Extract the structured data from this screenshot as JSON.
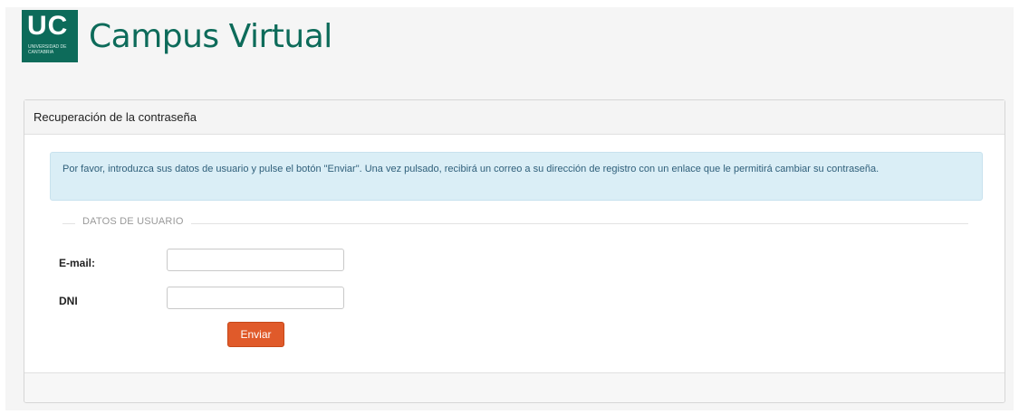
{
  "header": {
    "logo_text": "UC",
    "logo_subtext": "UNIVERSIDAD DE CANTABRIA",
    "brand_title": "Campus Virtual"
  },
  "panel": {
    "title": "Recuperación de la contraseña",
    "info_message": "Por favor, introduzca sus datos de usuario y pulse el botón \"Enviar\". Una vez pulsado, recibirá un correo a su dirección de registro con un enlace que le permitirá cambiar su contraseña.",
    "fieldset_legend": "DATOS DE USUARIO",
    "fields": {
      "email_label": "E-mail:",
      "email_value": "",
      "dni_label": "DNI",
      "dni_value": ""
    },
    "submit_label": "Enviar"
  },
  "colors": {
    "brand": "#0d6b5a",
    "info_bg": "#daeef6",
    "button": "#e05a2a"
  }
}
